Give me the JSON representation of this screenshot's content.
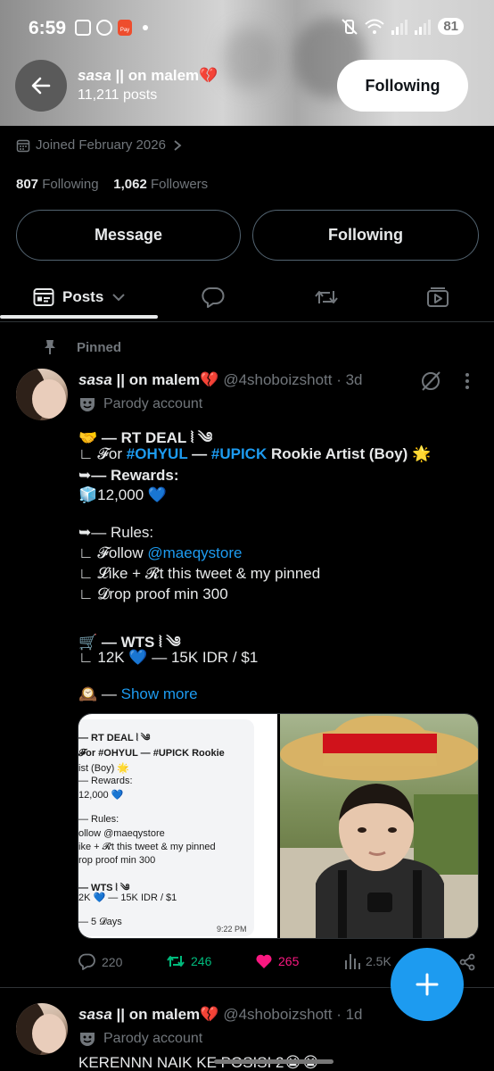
{
  "status_bar": {
    "time": "6:59",
    "battery": "81",
    "pay_label": "Pay"
  },
  "header": {
    "name": "sasa || on malem💔",
    "name_handle_part": "sasa",
    "name_rest": " || on malem💔",
    "post_count": "11,211 posts",
    "follow_label": "Following"
  },
  "profile": {
    "joined": "Joined February 2026",
    "following_count": "807",
    "following_label": "Following",
    "followers_count": "1,062",
    "followers_label": "Followers",
    "message_label": "Message",
    "following_button_label": "Following"
  },
  "tabs": {
    "posts_label": "Posts"
  },
  "pinned_label": "Pinned",
  "tweet1": {
    "name_italic": "sasa",
    "name_rest": " || on malem💔",
    "handle_time": "@4shoboizshott · 3d",
    "parody": "Parody account",
    "line1": "🤝 — RT DEAL ⦚ ༄",
    "line2_prefix": "∟ 𝓕or ",
    "line2_tag1": "#OHYUL",
    "line2_mid": " — ",
    "line2_tag2": "#UPICK",
    "line2_suffix": " Rookie Artist (Boy) 🌟",
    "line3": "➥— Rewards:",
    "line4": "🧊12,000 💙",
    "line5": "➥— Rules:",
    "line6_prefix": "∟ 𝓕ollow ",
    "line6_mention": "@maeqystore",
    "line7": "∟ 𝓛ike + 𝓡t this tweet & my pinned",
    "line8": "∟ 𝓓rop proof min 300",
    "line9": "🛒 — WTS ⦚ ༄",
    "line10": "∟ 12K 💙 — 15K IDR / $1",
    "line11_prefix": "🕰️ — ",
    "show_more": "Show more",
    "media_card": {
      "l1": "— RT DEAL ⦚ ༄",
      "l2": "𝓕or #OHYUL — #UPICK Rookie",
      "l3": "ist (Boy) 🌟",
      "l4": "— Rewards:",
      "l5": "12,000 💙",
      "l6": "— Rules:",
      "l7": "ollow @maeqystore",
      "l8": "ike + 𝓡t this tweet & my pinned",
      "l9": "rop proof min 300",
      "l10": "— WTS ⦚ ༄",
      "l11": "2K 💙 — 15K IDR / $1",
      "l12": "— 5 𝓓ays",
      "time": "9:22 PM"
    },
    "replies": "220",
    "reposts": "246",
    "likes": "265",
    "views": "2.5K"
  },
  "tweet2": {
    "name_italic": "sasa",
    "name_rest": " || on malem💔",
    "handle_time": "@4shoboizshott · 1d",
    "parody": "Parody account",
    "text": "KERENNN NAIK KE POSISI 2😭😭"
  },
  "colors": {
    "accent": "#1d9bf0",
    "repost": "#00ba7c",
    "like": "#f91880",
    "muted": "#71767b"
  }
}
